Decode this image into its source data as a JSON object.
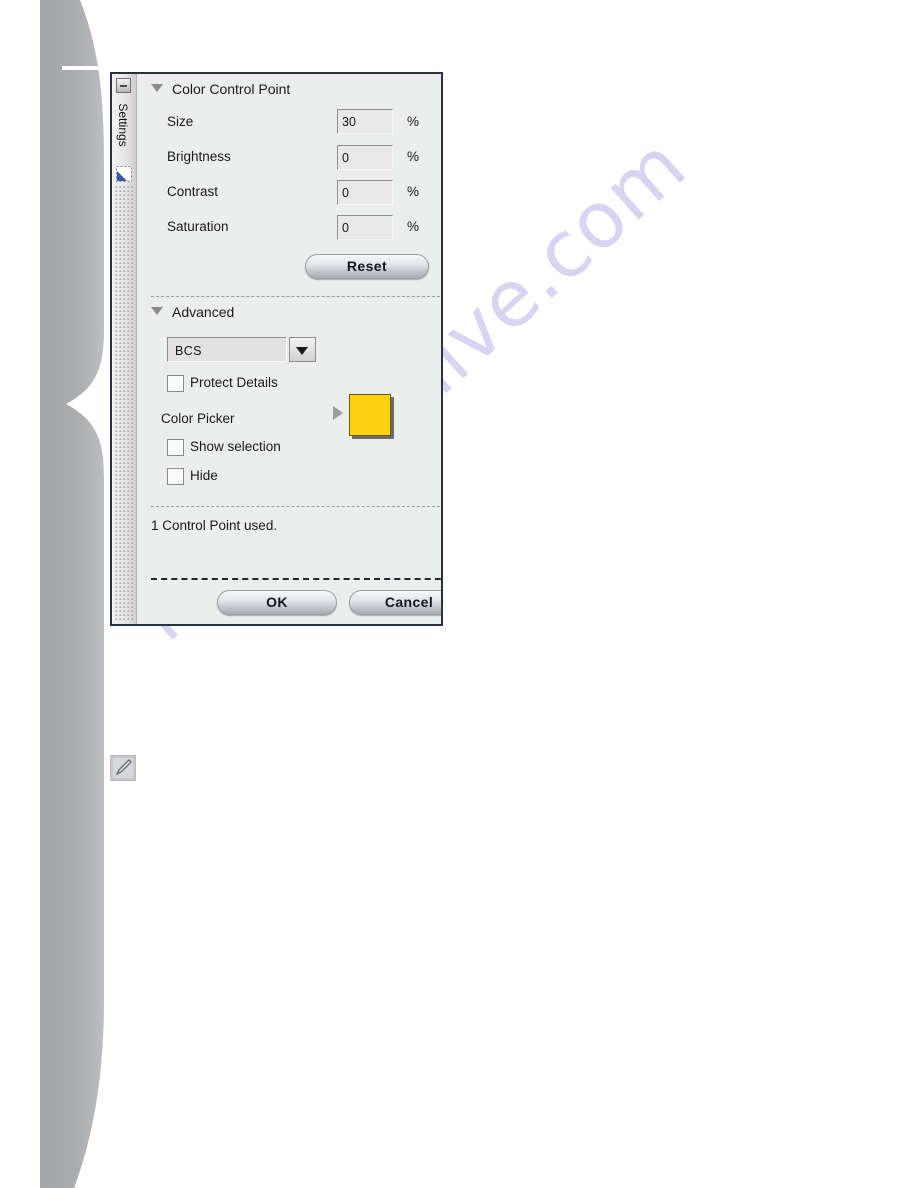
{
  "dialog": {
    "rail": {
      "label": "Settings",
      "minimize_icon": "minimize-icon",
      "panel_icon": "selection-marquee-icon"
    },
    "sections": [
      {
        "id": "color-control-point",
        "title": "Color Control Point",
        "rows": [
          {
            "label": "Size",
            "value": "30",
            "unit": "%"
          },
          {
            "label": "Brightness",
            "value": "0",
            "unit": "%"
          },
          {
            "label": "Contrast",
            "value": "0",
            "unit": "%"
          },
          {
            "label": "Saturation",
            "value": "0",
            "unit": "%"
          }
        ],
        "reset_label": "Reset"
      },
      {
        "id": "advanced",
        "title": "Advanced",
        "method_value": "BCS",
        "method_options": [
          "BCS"
        ],
        "checkboxes": [
          {
            "label": "Protect Details",
            "checked": false
          },
          {
            "label": "Show selection",
            "checked": false
          },
          {
            "label": "Hide",
            "checked": false
          }
        ],
        "color_picker_label": "Color Picker",
        "color_picker_value": "#FED113"
      }
    ],
    "status_text": "1 Control Point used.",
    "buttons": {
      "ok": "OK",
      "cancel": "Cancel"
    }
  },
  "page": {
    "watermark": "manualshive.com",
    "watermark_color": "#D7D5F2",
    "decor_color": "#A5A7AA",
    "note_icon": "pencil-note-icon"
  }
}
